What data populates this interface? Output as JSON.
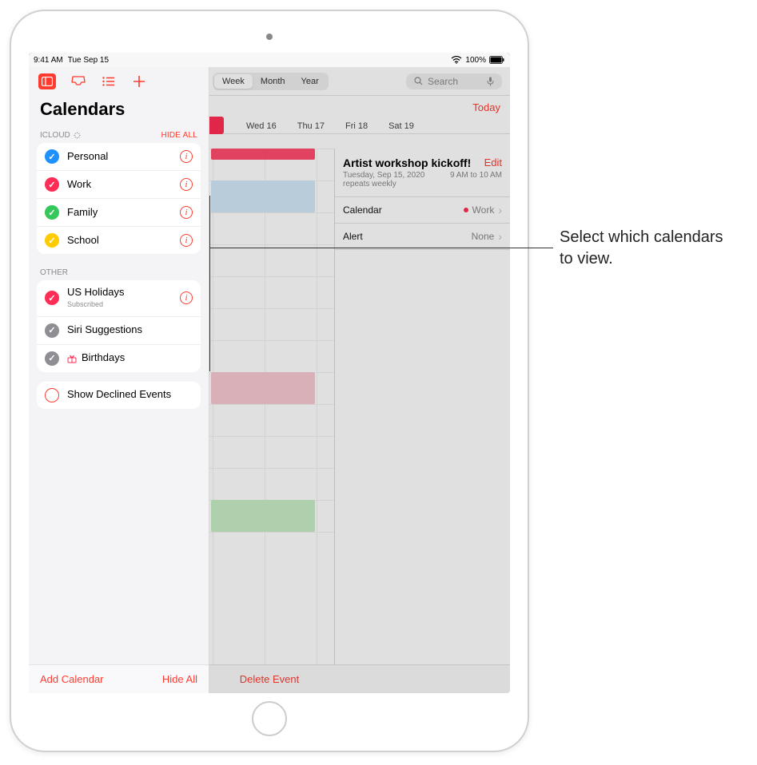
{
  "status_bar": {
    "time": "9:41 AM",
    "date": "Tue Sep 15",
    "battery": "100%"
  },
  "back": {
    "view_modes": {
      "week": "Week",
      "month": "Month",
      "year": "Year"
    },
    "search_placeholder": "Search",
    "today": "Today",
    "days": {
      "wed": "Wed 16",
      "thu": "Thu 17",
      "fri": "Fri 18",
      "sat": "Sat 19"
    },
    "delete_event": "Delete Event"
  },
  "event": {
    "title": "Artist workshop kickoff!",
    "edit": "Edit",
    "date": "Tuesday, Sep 15, 2020",
    "time": "9 AM to 10 AM",
    "repeats": "repeats weekly",
    "calendar_label": "Calendar",
    "calendar_value": "Work",
    "alert_label": "Alert",
    "alert_value": "None"
  },
  "sidebar": {
    "title": "Calendars",
    "section_icloud": "ICLOUD",
    "hide_all_caps": "HIDE ALL",
    "section_other": "OTHER",
    "items_icloud": [
      {
        "label": "Personal",
        "color": "cc-blue"
      },
      {
        "label": "Work",
        "color": "cc-pink"
      },
      {
        "label": "Family",
        "color": "cc-green"
      },
      {
        "label": "School",
        "color": "cc-yellow"
      }
    ],
    "items_other": [
      {
        "label": "US Holidays",
        "sub": "Subscribed",
        "color": "cc-pink",
        "info": true
      },
      {
        "label": "Siri Suggestions",
        "color": "cc-gray"
      },
      {
        "label": "Birthdays",
        "color": "cc-gray",
        "birthday": true
      }
    ],
    "show_declined": "Show Declined Events",
    "add_calendar": "Add Calendar",
    "hide_all": "Hide All"
  },
  "callout": "Select which calendars to view."
}
